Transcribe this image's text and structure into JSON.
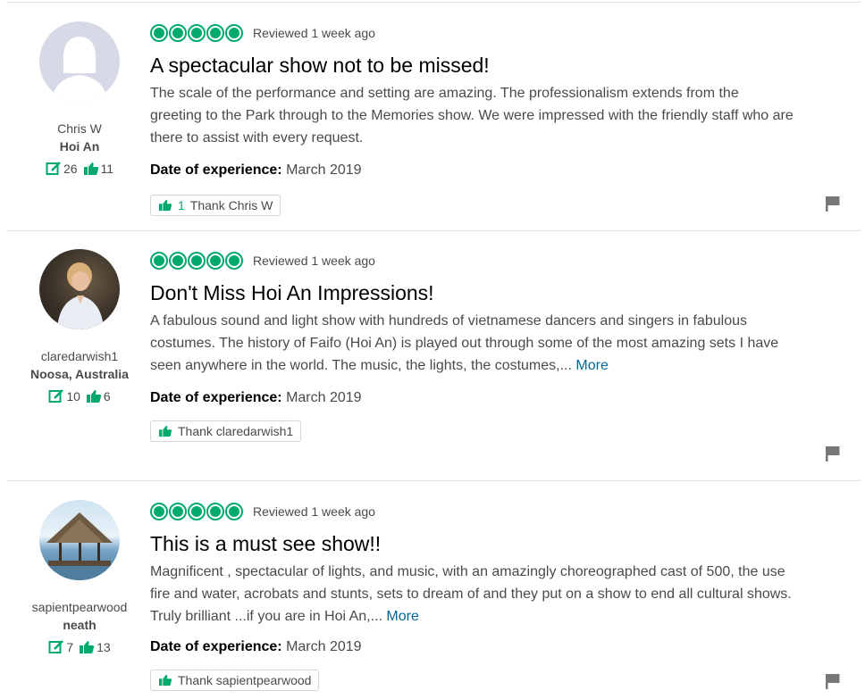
{
  "colors": {
    "accent": "#00aa6c",
    "link": "#006699"
  },
  "reviews": [
    {
      "avatar_icon": "default-user-avatar",
      "username": "Chris W",
      "location": "Hoi An",
      "contributions": "26",
      "helpful_votes": "11",
      "rating": 5,
      "review_date": "Reviewed 1 week ago",
      "title": "A spectacular show not to be missed!",
      "body": "The scale of the performance and setting are amazing. The professionalism extends from the greeting to the Park through to the Memories show. We were impressed with the friendly staff who are there to assist with every request.",
      "more_label": "",
      "date_label": "Date of experience:",
      "date_value": "March 2019",
      "thank_count": "1",
      "thank_label": "Thank Chris W"
    },
    {
      "avatar_icon": "woman-photo-avatar",
      "username": "claredarwish1",
      "location": "Noosa, Australia",
      "contributions": "10",
      "helpful_votes": "6",
      "rating": 5,
      "review_date": "Reviewed 1 week ago",
      "title": "Don't Miss Hoi An Impressions!",
      "body": "A fabulous sound and light show with hundreds of vietnamese dancers and singers in fabulous costumes. The history of Faifo (Hoi An) is played out through some of the most amazing sets I have seen anywhere in the world. The music, the lights, the costumes,...",
      "more_label": "More",
      "date_label": "Date of experience:",
      "date_value": "March 2019",
      "thank_count": "",
      "thank_label": "Thank claredarwish1"
    },
    {
      "avatar_icon": "beach-hut-photo-avatar",
      "username": "sapientpearwood",
      "location": "neath",
      "contributions": "7",
      "helpful_votes": "13",
      "rating": 5,
      "review_date": "Reviewed 1 week ago",
      "title": "This is a must see show!!",
      "body": "Magnificent , spectacular of lights, and music, with an amazingly choreographed cast of 500, the use fire and water, acrobats and stunts, sets to dream of and they put on a show to end all cultural shows. Truly brilliant ...if you are in Hoi An,...",
      "more_label": "More",
      "date_label": "Date of experience:",
      "date_value": "March 2019",
      "thank_count": "",
      "thank_label": "Thank sapientpearwood"
    }
  ]
}
